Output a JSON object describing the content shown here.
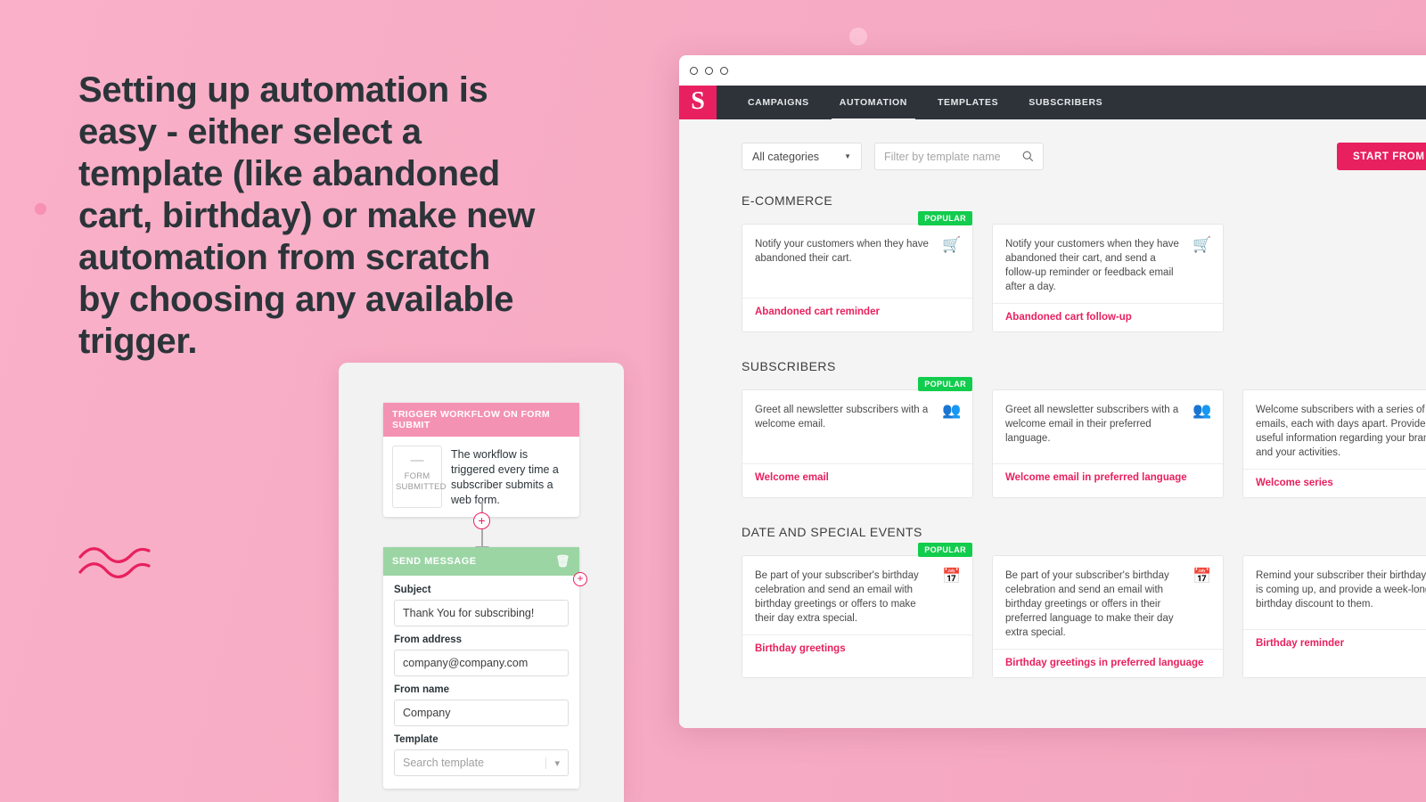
{
  "headline": {
    "lines": [
      "Setting up automation is",
      "easy - either select a",
      "template (like abandoned",
      "cart, birthday) or make new",
      "automation from scratch",
      "by choosing any available",
      "trigger."
    ]
  },
  "colors": {
    "background_pink": "#F8AEC6",
    "brand_crimson": "#E8205F",
    "navbar_dark": "#2D3339",
    "badge_green": "#12CC4D",
    "trigger_header_pink": "#F492B4",
    "send_header_green": "#9BD5A4"
  },
  "workflow": {
    "trigger": {
      "header": "TRIGGER WORKFLOW ON FORM SUBMIT",
      "icon_caption_line1": "FORM",
      "icon_caption_line2": "SUBMITTED",
      "icon": "form-icon",
      "description": "The workflow is triggered every time a subscriber submits a web form."
    },
    "add_step_button": "+",
    "send_message": {
      "header": "SEND MESSAGE",
      "delete_icon": "trash-icon",
      "fields": [
        {
          "label": "Subject",
          "value": "Thank You for subscribing!",
          "type": "text"
        },
        {
          "label": "From address",
          "value": "company@company.com",
          "type": "text"
        },
        {
          "label": "From name",
          "value": "Company",
          "type": "text"
        },
        {
          "label": "Template",
          "value": "Search template",
          "type": "select",
          "is_placeholder": true
        }
      ]
    }
  },
  "browser": {
    "titlebar_dots": 3,
    "logo_letter": "S",
    "nav_tabs": [
      {
        "label": "CAMPAIGNS",
        "active": false
      },
      {
        "label": "AUTOMATION",
        "active": true
      },
      {
        "label": "TEMPLATES",
        "active": false
      },
      {
        "label": "SUBSCRIBERS",
        "active": false
      }
    ],
    "toolbar": {
      "category_select_value": "All categories",
      "search_placeholder": "Filter by template name",
      "search_icon": "search-icon",
      "start_scratch_label": "START FROM SCRATCH"
    },
    "sections": [
      {
        "title": "E-COMMERCE",
        "cards": [
          {
            "description": "Notify your customers when they have abandoned their cart.",
            "name": "Abandoned cart reminder",
            "icon": "shopping-basket-icon",
            "badge": "POPULAR"
          },
          {
            "description": "Notify your customers when they have abandoned their cart, and send a follow-up reminder or feedback email after a day.",
            "name": "Abandoned cart follow-up",
            "icon": "shopping-basket-icon",
            "badge": ""
          }
        ]
      },
      {
        "title": "SUBSCRIBERS",
        "cards": [
          {
            "description": "Greet all newsletter subscribers with a welcome email.",
            "name": "Welcome email",
            "icon": "people-icon",
            "badge": "POPULAR"
          },
          {
            "description": "Greet all newsletter subscribers with a welcome email in their preferred language.",
            "name": "Welcome email in preferred language",
            "icon": "people-icon",
            "badge": ""
          },
          {
            "description": "Welcome subscribers with a series of emails, each with days apart. Provide useful information regarding your brand and your activities.",
            "name": "Welcome series",
            "icon": "people-icon",
            "badge": ""
          }
        ]
      },
      {
        "title": "DATE AND SPECIAL EVENTS",
        "cards": [
          {
            "description": "Be part of your subscriber's birthday celebration and send an email with birthday greetings or offers to make their day extra special.",
            "name": "Birthday greetings",
            "icon": "calendar-icon",
            "badge": "POPULAR"
          },
          {
            "description": "Be part of your subscriber's birthday celebration and send an email with birthday greetings or offers in their preferred language to make their day extra special.",
            "name": "Birthday greetings in preferred language",
            "icon": "calendar-icon",
            "badge": ""
          },
          {
            "description": "Remind your subscriber their birthday is coming up, and provide a week-long birthday discount to them.",
            "name": "Birthday reminder",
            "icon": "calendar-icon",
            "badge": ""
          }
        ]
      }
    ]
  }
}
